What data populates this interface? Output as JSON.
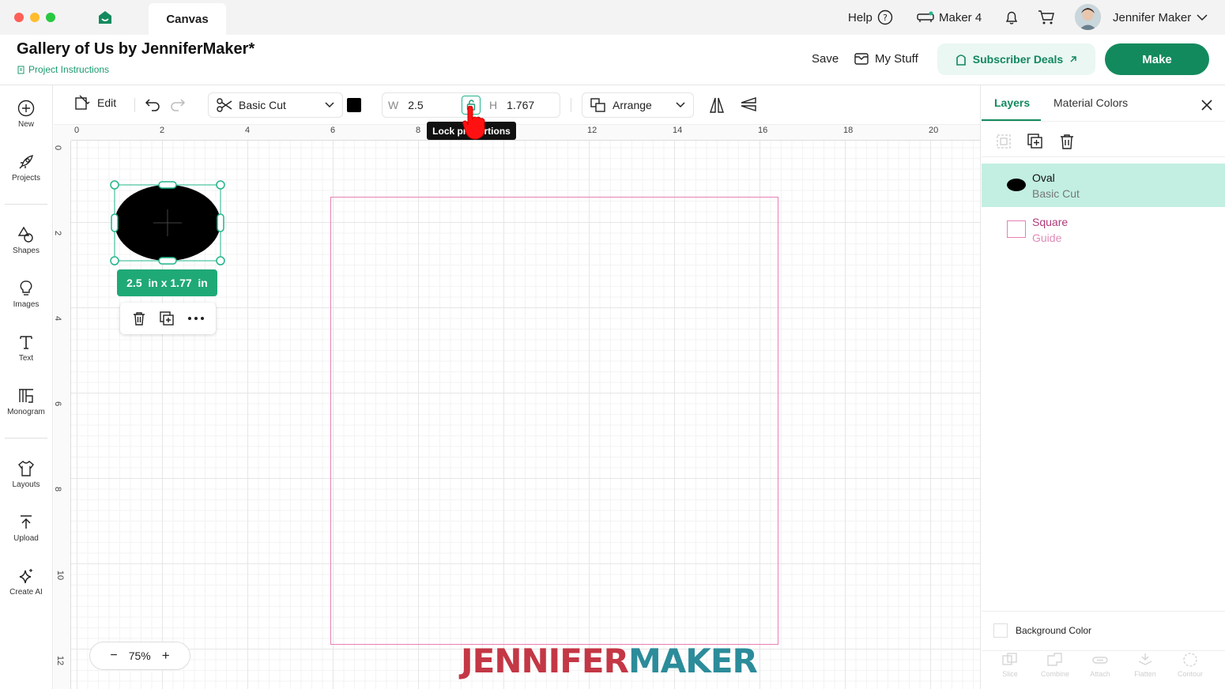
{
  "window": {
    "tab_label": "Canvas"
  },
  "topbar": {
    "help_label": "Help",
    "machine_label": "Maker 4",
    "user_name": "Jennifer Maker"
  },
  "header": {
    "project_title": "Gallery of Us by JenniferMaker*",
    "instructions_label": "Project Instructions",
    "save_label": "Save",
    "mystuff_label": "My Stuff",
    "deals_label": "Subscriber Deals",
    "make_label": "Make"
  },
  "sidebar": {
    "items": [
      {
        "label": "New",
        "icon": "plus-circle-icon"
      },
      {
        "label": "Projects",
        "icon": "rocket-icon"
      },
      {
        "label": "Shapes",
        "icon": "shapes-icon"
      },
      {
        "label": "Images",
        "icon": "lightbulb-icon"
      },
      {
        "label": "Text",
        "icon": "text-icon"
      },
      {
        "label": "Monogram",
        "icon": "monogram-icon"
      },
      {
        "label": "Layouts",
        "icon": "shirt-icon"
      },
      {
        "label": "Upload",
        "icon": "upload-icon"
      },
      {
        "label": "Create AI",
        "icon": "sparkle-icon"
      }
    ]
  },
  "toolbar": {
    "edit_label": "Edit",
    "operation_label": "Basic Cut",
    "width_label": "W",
    "width_value": "2.5",
    "height_label": "H",
    "height_value": "1.767",
    "arrange_label": "Arrange",
    "tooltip_label": "Lock proportions",
    "color_swatch": "#000000"
  },
  "ruler": {
    "top": [
      "0",
      "2",
      "4",
      "6",
      "8",
      "10",
      "12",
      "14",
      "16",
      "18",
      "20"
    ],
    "left": [
      "0",
      "2",
      "4",
      "6",
      "8",
      "10",
      "12"
    ]
  },
  "selection": {
    "size_label": "2.5  in x 1.77  in"
  },
  "zoom": {
    "minus": "−",
    "value": "75%",
    "plus": "+"
  },
  "layers_panel": {
    "tabs": [
      "Layers",
      "Material Colors"
    ],
    "layers": [
      {
        "name": "Oval",
        "operation": "Basic Cut",
        "selected": true,
        "color": "#000000"
      },
      {
        "name": "Square",
        "operation": "Guide",
        "selected": false,
        "color": "#e86aa8"
      }
    ],
    "background_color_label": "Background Color",
    "bottom_tools": [
      "Slice",
      "Combine",
      "Attach",
      "Flatten",
      "Contour"
    ]
  },
  "watermark": {
    "part1": "JENNIFER",
    "part2": "MAKER"
  },
  "colors": {
    "brand_green": "#138a5e",
    "selection_teal": "#21b58a",
    "guide_pink": "#e87fb2",
    "layer_selected_bg": "#c2efe2"
  }
}
